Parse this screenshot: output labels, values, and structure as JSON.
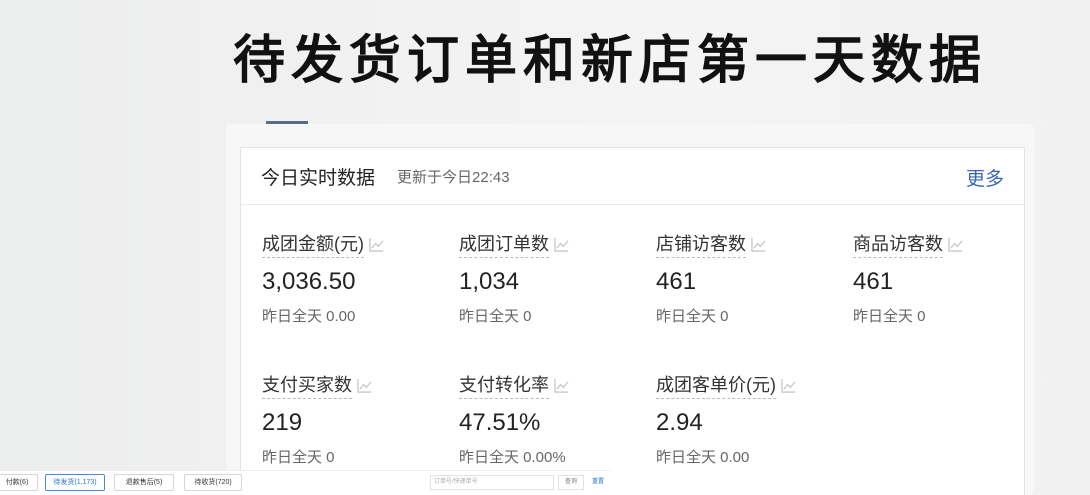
{
  "headline": "待发货订单和新店第一天数据",
  "card": {
    "title": "今日实时数据",
    "updated": "更新于今日22:43",
    "more": "更多"
  },
  "metrics": [
    {
      "label": "成团金额(元)",
      "value": "3,036.50",
      "prev": "昨日全天 0.00"
    },
    {
      "label": "成团订单数",
      "value": "1,034",
      "prev": "昨日全天 0"
    },
    {
      "label": "店铺访客数",
      "value": "461",
      "prev": "昨日全天 0"
    },
    {
      "label": "商品访客数",
      "value": "461",
      "prev": "昨日全天 0"
    },
    {
      "label": "支付买家数",
      "value": "219",
      "prev": "昨日全天 0"
    },
    {
      "label": "支付转化率",
      "value": "47.51%",
      "prev": "昨日全天 0.00%"
    },
    {
      "label": "成团客单价(元)",
      "value": "2.94",
      "prev": "昨日全天 0.00"
    }
  ],
  "toolbar": {
    "unpaid": "付款(6)",
    "pending_ship": "待发货(1,173)",
    "refund": "退款售后(5)",
    "pending_receive": "待收货(720)",
    "search_placeholder": "订单号/快递单号",
    "query": "查询",
    "reset": "重置"
  },
  "colors": {
    "accent": "#3a66b5",
    "toolbar_active": "#2d6fd6"
  }
}
